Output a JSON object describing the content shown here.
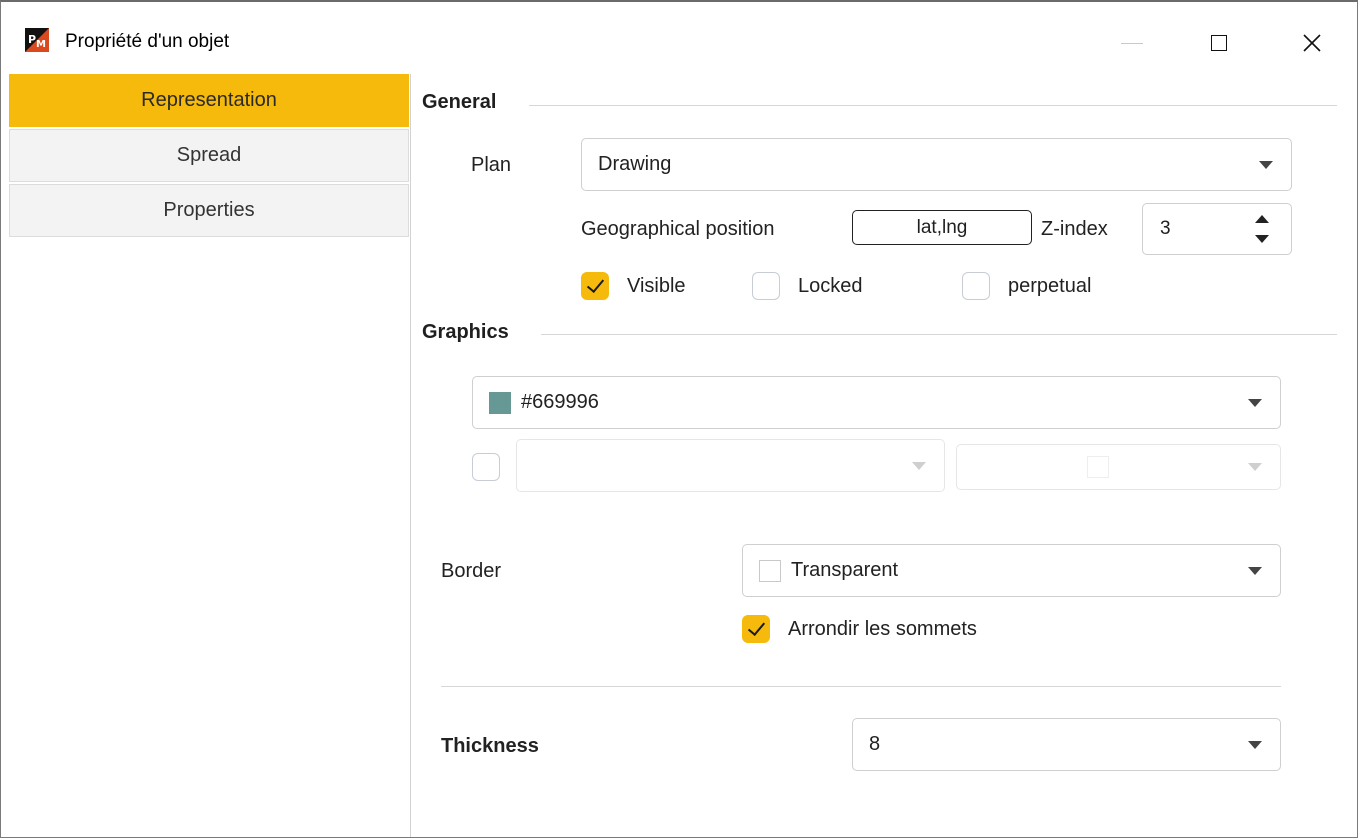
{
  "window": {
    "title": "Propriété d'un objet",
    "icon": "pm-app-icon"
  },
  "sidebar": {
    "items": [
      {
        "label": "Representation",
        "active": true
      },
      {
        "label": "Spread",
        "active": false
      },
      {
        "label": "Properties",
        "active": false
      }
    ]
  },
  "general": {
    "header": "General",
    "plan_label": "Plan",
    "plan_value": "Drawing",
    "geo_label": "Geographical position",
    "geo_button": "lat,lng",
    "zindex_label": "Z-index",
    "zindex_value": "3",
    "visible_label": "Visible",
    "visible_checked": true,
    "locked_label": "Locked",
    "locked_checked": false,
    "perpetual_label": "perpetual",
    "perpetual_checked": false
  },
  "graphics": {
    "header": "Graphics",
    "fill_color_value": "#669996",
    "fill_swatch_color": "#669996",
    "secondary_checked": false,
    "border_label": "Border",
    "border_value": "Transparent",
    "round_label": "Arrondir les sommets",
    "round_checked": true,
    "thickness_label": "Thickness",
    "thickness_value": "8"
  },
  "colors": {
    "accent": "#f6ba0d"
  }
}
